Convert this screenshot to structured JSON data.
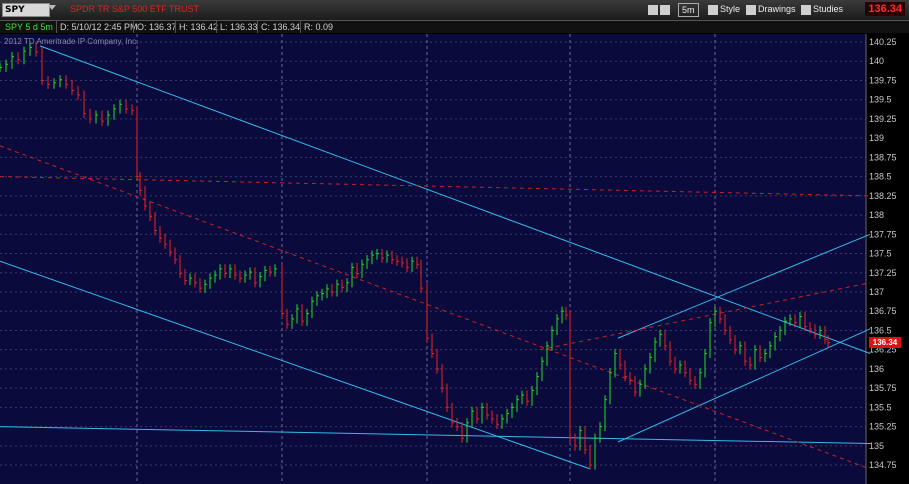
{
  "toolbar": {
    "symbol": "SPY",
    "description": "SPDR TR S&P 500 ETF TRUST",
    "aggregation": "5m",
    "style_label": "Style",
    "drawings_label": "Drawings",
    "studies_label": "Studies",
    "last_price": "136.34"
  },
  "infobar": {
    "study": "SPY 5 d 5m",
    "date": "D: 5/10/12 2:45 PM",
    "open": "O: 136.37",
    "high": "H: 136.42",
    "low": "L: 136.33",
    "close": "C: 136.34",
    "range": "R: 0.09"
  },
  "copyright": "2012 TD Ameritrade IP Company, Inc.",
  "price_tag": "136.34",
  "colors": {
    "background": "#0a0a3c",
    "grid": "#3a3a6a",
    "up_bar": "#22dd22",
    "down_bar": "#ee2222",
    "trendline": "#33bbee",
    "dashed_line": "#cc2222",
    "price_tag": "#e01010"
  },
  "chart_data": {
    "type": "bar",
    "title": "SPY 5 d 5m",
    "y_ticks": [
      "140.25",
      "140",
      "139.75",
      "139.5",
      "139.25",
      "139",
      "138.75",
      "138.5",
      "138.25",
      "138",
      "137.75",
      "137.5",
      "137.25",
      "137",
      "136.75",
      "136.5",
      "136.25",
      "136",
      "135.75",
      "135.5",
      "135.25",
      "135",
      "134.75"
    ],
    "ylim": [
      134.7,
      140.3
    ],
    "grid": true,
    "series": [
      {
        "values": [
          [
            0,
            139.92
          ],
          [
            6,
            139.96
          ],
          [
            12,
            140.06
          ],
          [
            18,
            140.02
          ],
          [
            24,
            140.13
          ],
          [
            30,
            140.18
          ],
          [
            36,
            140.12
          ],
          [
            42,
            139.75
          ],
          [
            48,
            139.7
          ],
          [
            54,
            139.72
          ],
          [
            60,
            139.76
          ],
          [
            66,
            139.7
          ],
          [
            72,
            139.62
          ],
          [
            78,
            139.56
          ],
          [
            84,
            139.32
          ],
          [
            90,
            139.25
          ],
          [
            96,
            139.3
          ],
          [
            102,
            139.22
          ],
          [
            108,
            139.3
          ],
          [
            114,
            139.38
          ],
          [
            120,
            139.44
          ],
          [
            126,
            139.38
          ],
          [
            132,
            139.36
          ],
          [
            137,
            138.5
          ],
          [
            140,
            138.32
          ],
          [
            145,
            138.12
          ],
          [
            150,
            137.98
          ],
          [
            155,
            137.8
          ],
          [
            160,
            137.7
          ],
          [
            165,
            137.62
          ],
          [
            170,
            137.52
          ],
          [
            175,
            137.42
          ],
          [
            180,
            137.24
          ],
          [
            185,
            137.15
          ],
          [
            190,
            137.18
          ],
          [
            195,
            137.12
          ],
          [
            200,
            137.05
          ],
          [
            205,
            137.1
          ],
          [
            210,
            137.18
          ],
          [
            215,
            137.22
          ],
          [
            220,
            137.3
          ],
          [
            225,
            137.24
          ],
          [
            230,
            137.3
          ],
          [
            235,
            137.22
          ],
          [
            240,
            137.18
          ],
          [
            245,
            137.22
          ],
          [
            250,
            137.26
          ],
          [
            255,
            137.12
          ],
          [
            260,
            137.2
          ],
          [
            265,
            137.28
          ],
          [
            270,
            137.26
          ],
          [
            275,
            137.3
          ],
          [
            282,
            136.72
          ],
          [
            287,
            136.58
          ],
          [
            292,
            136.65
          ],
          [
            297,
            136.78
          ],
          [
            302,
            136.62
          ],
          [
            307,
            136.72
          ],
          [
            312,
            136.88
          ],
          [
            317,
            136.95
          ],
          [
            322,
            136.98
          ],
          [
            327,
            137.04
          ],
          [
            332,
            137.0
          ],
          [
            337,
            137.1
          ],
          [
            342,
            137.06
          ],
          [
            347,
            137.12
          ],
          [
            352,
            137.32
          ],
          [
            357,
            137.24
          ],
          [
            362,
            137.36
          ],
          [
            367,
            137.42
          ],
          [
            372,
            137.48
          ],
          [
            377,
            137.5
          ],
          [
            382,
            137.44
          ],
          [
            387,
            137.48
          ],
          [
            392,
            137.42
          ],
          [
            397,
            137.4
          ],
          [
            402,
            137.38
          ],
          [
            407,
            137.32
          ],
          [
            412,
            137.4
          ],
          [
            417,
            137.36
          ],
          [
            421,
            137.05
          ],
          [
            427,
            136.4
          ],
          [
            432,
            136.2
          ],
          [
            437,
            136.0
          ],
          [
            442,
            135.75
          ],
          [
            447,
            135.5
          ],
          [
            452,
            135.3
          ],
          [
            457,
            135.25
          ],
          [
            462,
            135.1
          ],
          [
            467,
            135.3
          ],
          [
            472,
            135.45
          ],
          [
            477,
            135.35
          ],
          [
            482,
            135.5
          ],
          [
            487,
            135.4
          ],
          [
            492,
            135.35
          ],
          [
            497,
            135.28
          ],
          [
            502,
            135.35
          ],
          [
            507,
            135.42
          ],
          [
            512,
            135.5
          ],
          [
            517,
            135.6
          ],
          [
            522,
            135.66
          ],
          [
            527,
            135.58
          ],
          [
            532,
            135.72
          ],
          [
            537,
            135.9
          ],
          [
            542,
            136.1
          ],
          [
            547,
            136.3
          ],
          [
            552,
            136.5
          ],
          [
            557,
            136.65
          ],
          [
            562,
            136.75
          ],
          [
            566,
            136.7
          ],
          [
            570,
            135.1
          ],
          [
            575,
            135.0
          ],
          [
            580,
            135.2
          ],
          [
            585,
            134.95
          ],
          [
            590,
            134.75
          ],
          [
            595,
            135.1
          ],
          [
            600,
            135.25
          ],
          [
            605,
            135.6
          ],
          [
            610,
            135.95
          ],
          [
            615,
            136.2
          ],
          [
            620,
            136.05
          ],
          [
            625,
            135.9
          ],
          [
            630,
            135.85
          ],
          [
            635,
            135.7
          ],
          [
            640,
            135.8
          ],
          [
            645,
            136.0
          ],
          [
            650,
            136.15
          ],
          [
            655,
            136.35
          ],
          [
            660,
            136.45
          ],
          [
            665,
            136.3
          ],
          [
            670,
            136.1
          ],
          [
            675,
            136.0
          ],
          [
            680,
            136.05
          ],
          [
            685,
            135.95
          ],
          [
            690,
            135.85
          ],
          [
            695,
            135.8
          ],
          [
            700,
            135.95
          ],
          [
            705,
            136.2
          ],
          [
            710,
            136.6
          ],
          [
            715,
            136.75
          ],
          [
            720,
            136.65
          ],
          [
            725,
            136.5
          ],
          [
            730,
            136.38
          ],
          [
            735,
            136.25
          ],
          [
            740,
            136.3
          ],
          [
            745,
            136.1
          ],
          [
            750,
            136.05
          ],
          [
            755,
            136.25
          ],
          [
            760,
            136.15
          ],
          [
            765,
            136.2
          ],
          [
            770,
            136.3
          ],
          [
            775,
            136.42
          ],
          [
            780,
            136.5
          ],
          [
            785,
            136.62
          ],
          [
            790,
            136.65
          ],
          [
            795,
            136.6
          ],
          [
            800,
            136.68
          ],
          [
            805,
            136.55
          ],
          [
            810,
            136.52
          ],
          [
            815,
            136.45
          ],
          [
            820,
            136.5
          ],
          [
            825,
            136.38
          ],
          [
            828,
            136.34
          ]
        ]
      }
    ],
    "trendlines_price": [
      {
        "style": "solid",
        "points": [
          [
            40,
            140.2
          ],
          [
            870,
            136.2
          ]
        ]
      },
      {
        "style": "solid",
        "points": [
          [
            0,
            137.4
          ],
          [
            590,
            134.7
          ]
        ]
      },
      {
        "style": "solid",
        "points": [
          [
            0,
            135.25
          ],
          [
            870,
            135.03
          ]
        ]
      },
      {
        "style": "solid",
        "points": [
          [
            618,
            136.4
          ],
          [
            870,
            137.75
          ]
        ]
      },
      {
        "style": "solid",
        "points": [
          [
            618,
            135.05
          ],
          [
            870,
            136.52
          ]
        ]
      },
      {
        "style": "dashed",
        "points": [
          [
            0,
            138.9
          ],
          [
            870,
            134.7
          ]
        ]
      },
      {
        "style": "dashed",
        "points": [
          [
            0,
            138.5
          ],
          [
            870,
            138.25
          ]
        ]
      },
      {
        "style": "dashed",
        "points": [
          [
            540,
            136.25
          ],
          [
            870,
            137.12
          ]
        ]
      }
    ]
  }
}
